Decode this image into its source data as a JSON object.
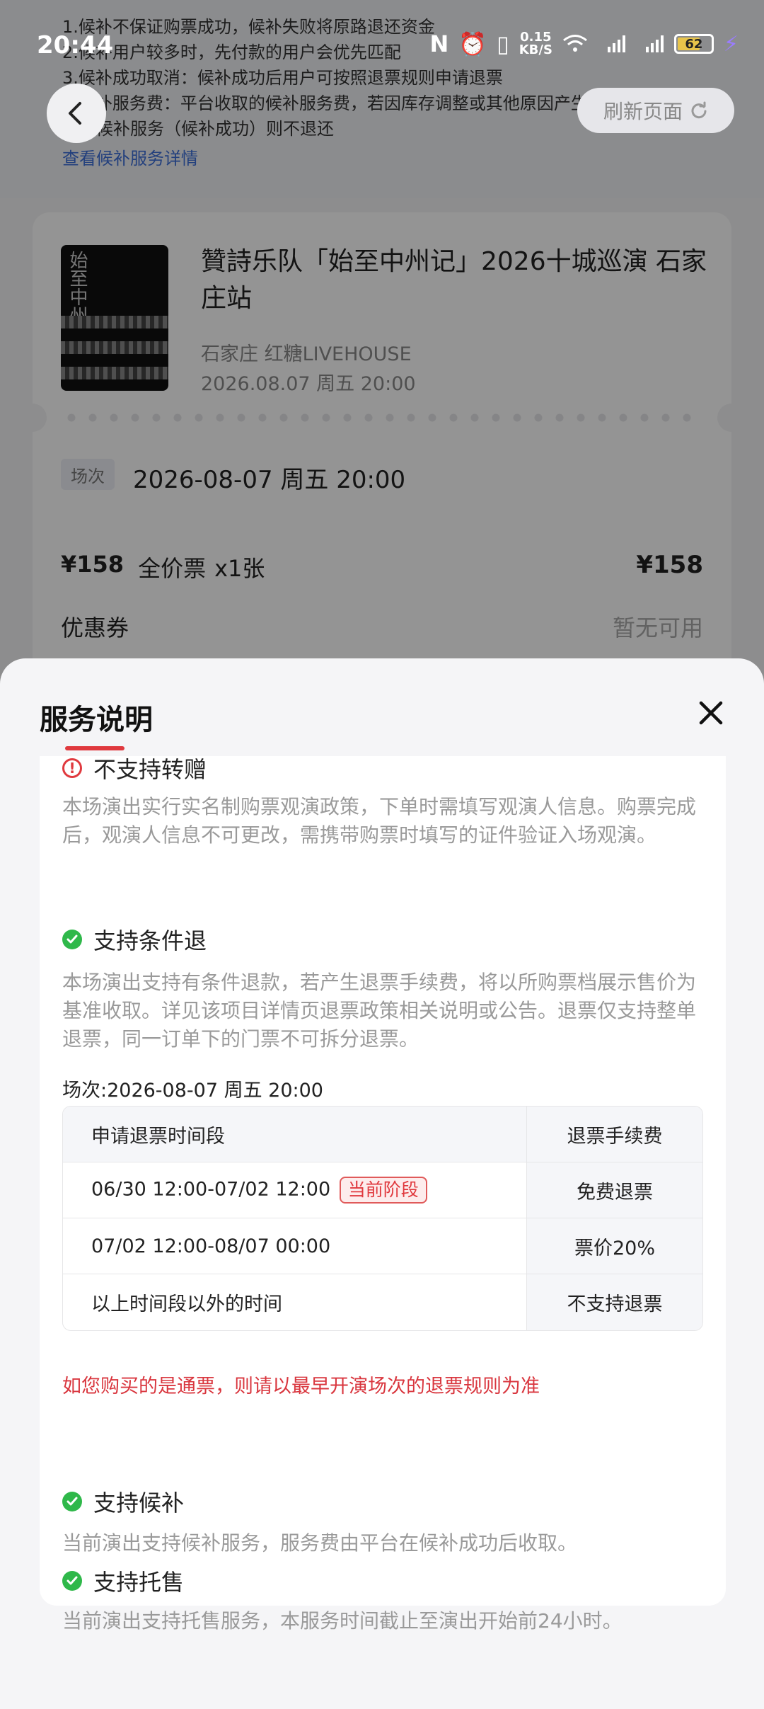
{
  "status_bar": {
    "time": "20:44",
    "speed_value": "0.15",
    "speed_unit": "KB/S",
    "battery": "62",
    "battery_level": 0.62
  },
  "notice": {
    "lines": [
      "1.候补不保证购票成功，候补失败将原路退还资金",
      "2.候补用户较多时，先付款的用户会优先匹配",
      "3.候补成功取消：候补成功后用户可按照退票规则申请退票",
      "4.候补服务费：平台收取的候补服务费，若因库存调整或其他原因产生",
      "接受候补服务（候补成功）则不退还"
    ],
    "link": "查看候补服务详情"
  },
  "header": {
    "refresh_label": "刷新页面"
  },
  "order": {
    "title": "贊詩乐队「始至中州记」2026十城巡演 石家庄站",
    "venue": "石家庄   红糖LIVEHOUSE",
    "date": "2026.08.07 周五 20:00",
    "session_tag": "场次",
    "session_value": "2026-08-07 周五 20:00",
    "unit_price": "¥158",
    "ticket_type": "全价票",
    "quantity": "x1张",
    "total": "¥158",
    "coupon_label": "优惠券",
    "coupon_value": "暂无可用"
  },
  "sheet": {
    "title": "服务说明",
    "sections": {
      "transfer": {
        "title": "不支持转赠",
        "desc": "本场演出实行实名制购票观演政策，下单时需填写观演人信息。购票完成后，观演人信息不可更改，需携带购票时填写的证件验证入场观演。"
      },
      "refund": {
        "title": "支持条件退",
        "desc": "本场演出支持有条件退款，若产生退票手续费，将以所购票档展示售价为基准收取。详见该项目详情页退票政策相关说明或公告。退票仅支持整单退票，同一订单下的门票不可拆分退票。",
        "session_line": "场次:2026-08-07 周五 20:00",
        "table": {
          "header": {
            "period": "申请退票时间段",
            "fee": "退票手续费"
          },
          "rows": [
            {
              "period": "06/30 12:00-07/02 12:00",
              "badge": "当前阶段",
              "fee": "免费退票"
            },
            {
              "period": "07/02 12:00-08/07 00:00",
              "badge": "",
              "fee": "票价20%"
            },
            {
              "period": "以上时间段以外的时间",
              "badge": "",
              "fee": "不支持退票"
            }
          ]
        },
        "note": "如您购买的是通票，则请以最早开演场次的退票规则为准"
      },
      "waitlist": {
        "title": "支持候补",
        "desc": "当前演出支持候补服务，服务费由平台在候补成功后收取。"
      },
      "resale": {
        "title": "支持托售",
        "desc": "当前演出支持托售服务，本服务时间截止至演出开始前24小时。"
      }
    }
  },
  "colors": {
    "accent_red": "#e0393e",
    "check_green": "#2fb84a",
    "link_blue": "#3d6fd8"
  }
}
